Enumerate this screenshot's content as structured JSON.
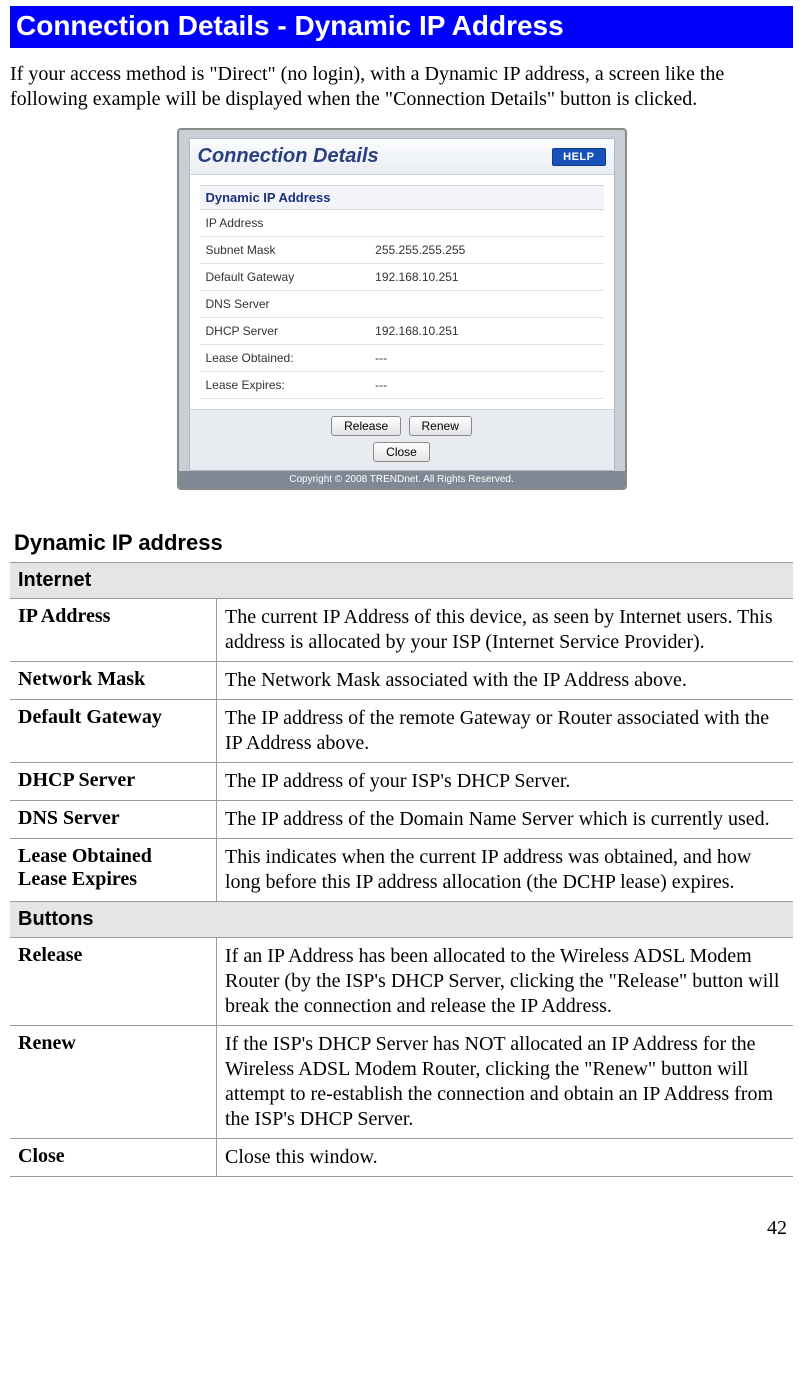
{
  "title": "Connection Details - Dynamic IP Address",
  "intro": "If your access method is \"Direct\" (no login), with a Dynamic IP address, a screen like the following example will be displayed when the \"Connection Details\" button is clicked.",
  "screenshot": {
    "header_title": "Connection Details",
    "help_label": "HELP",
    "section_title": "Dynamic IP Address",
    "rows": [
      {
        "label": "IP Address",
        "value": ""
      },
      {
        "label": "Subnet Mask",
        "value": "255.255.255.255"
      },
      {
        "label": "Default Gateway",
        "value": "192.168.10.251"
      },
      {
        "label": "DNS Server",
        "value": ""
      },
      {
        "label": "DHCP Server",
        "value": "192.168.10.251"
      },
      {
        "label": "Lease Obtained:",
        "value": "---"
      },
      {
        "label": "Lease Expires:",
        "value": "---"
      }
    ],
    "buttons": {
      "release": "Release",
      "renew": "Renew",
      "close": "Close"
    },
    "footer": "Copyright © 2008 TRENDnet. All Rights Reserved."
  },
  "subheading": "Dynamic IP address",
  "sections": [
    {
      "title": "Internet",
      "rows": [
        {
          "term": "IP Address",
          "def": "The current IP Address of this device, as seen by Internet users. This address is allocated by your ISP (Internet Service Provider)."
        },
        {
          "term": "Network Mask",
          "def": "The Network Mask associated with the IP Address above."
        },
        {
          "term": "Default Gateway",
          "def": "The IP address of the remote Gateway or Router associated with the IP Address above."
        },
        {
          "term": "DHCP Server",
          "def": "The IP address of your ISP's DHCP Server."
        },
        {
          "term": "DNS Server",
          "def": "The IP address of the Domain Name Server which is currently used."
        },
        {
          "term": "Lease Obtained\nLease Expires",
          "def": "This indicates when the current IP address was obtained, and how long before this IP address allocation (the DCHP lease) expires."
        }
      ]
    },
    {
      "title": "Buttons",
      "rows": [
        {
          "term": "Release",
          "def": "If an IP Address has been allocated to the Wireless ADSL Modem Router (by the ISP's DHCP Server, clicking the \"Release\" button will break the connection and release the IP Address."
        },
        {
          "term": "Renew",
          "def": "If the ISP's DHCP Server has NOT allocated an IP Address for the Wireless ADSL Modem Router, clicking the \"Renew\" button will attempt to re-establish the connection and obtain an IP Address from the ISP's DHCP Server."
        },
        {
          "term": "Close",
          "def": "Close this window."
        }
      ]
    }
  ],
  "page_number": "42"
}
